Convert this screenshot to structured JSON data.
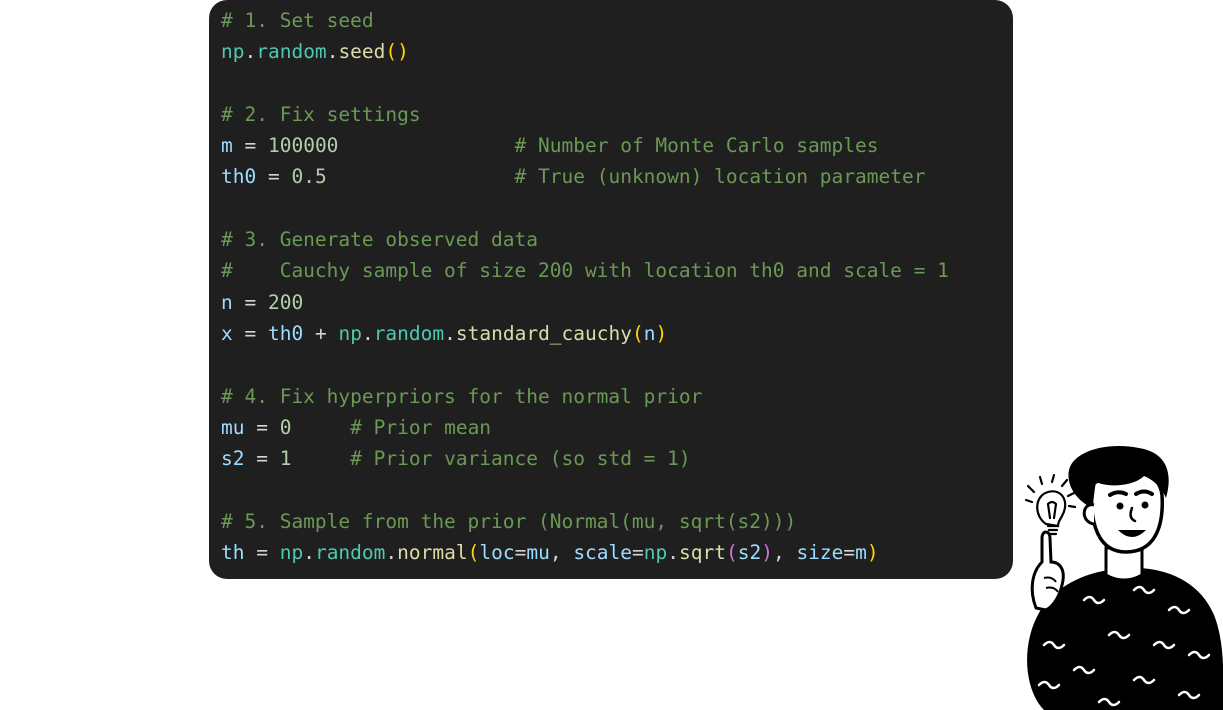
{
  "code": {
    "l1": {
      "comment": "# 1. Set seed"
    },
    "l2": {
      "mod": "np",
      "d1": ".",
      "attr": "random",
      "d2": ".",
      "fn": "seed",
      "open": "(",
      "close": ")"
    },
    "l4": {
      "comment": "# 2. Fix settings"
    },
    "l5": {
      "var": "m",
      "eq": " = ",
      "num": "100000",
      "pad": "               ",
      "comment": "# Number of Monte Carlo samples"
    },
    "l6": {
      "var": "th0",
      "eq": " = ",
      "num": "0.5",
      "pad": "                ",
      "comment": "# True (unknown) location parameter"
    },
    "l8": {
      "comment": "# 3. Generate observed data"
    },
    "l9": {
      "comment": "#    Cauchy sample of size 200 with location th0 and scale = 1"
    },
    "l10": {
      "var": "n",
      "eq": " = ",
      "num": "200"
    },
    "l11": {
      "var": "x",
      "eq": " = ",
      "var2": "th0",
      "plus": " + ",
      "mod": "np",
      "d1": ".",
      "attr": "random",
      "d2": ".",
      "fn": "standard_cauchy",
      "open": "(",
      "arg": "n",
      "close": ")"
    },
    "l13": {
      "comment": "# 4. Fix hyperpriors for the normal prior"
    },
    "l14": {
      "var": "mu",
      "eq": " = ",
      "num": "0",
      "pad": "     ",
      "comment": "# Prior mean"
    },
    "l15": {
      "var": "s2",
      "eq": " = ",
      "num": "1",
      "pad": "     ",
      "comment": "# Prior variance (so std = 1)"
    },
    "l17": {
      "comment": "# 5. Sample from the prior (Normal(mu, sqrt(s2)))"
    },
    "l18": {
      "var": "th",
      "eq": " = ",
      "mod": "np",
      "d1": ".",
      "attr": "random",
      "d2": ".",
      "fn": "normal",
      "open": "(",
      "k1": "loc",
      "e1": "=",
      "v1": "mu",
      "sep1": ", ",
      "k2": "scale",
      "e2": "=",
      "mod2": "np",
      "d3": ".",
      "fn2": "sqrt",
      "open2": "(",
      "arg2": "s2",
      "close2": ")",
      "sep2": ", ",
      "k3": "size",
      "e3": "=",
      "v3": "m",
      "close": ")"
    }
  },
  "illustration": {
    "subject": "person-with-lightbulb-idea"
  },
  "colors": {
    "editor_bg": "#1f1f1f",
    "comment": "#6a9955",
    "variable": "#9cdcfe",
    "number": "#b5cea8",
    "module": "#4ec9b0",
    "function": "#dcdcaa"
  }
}
